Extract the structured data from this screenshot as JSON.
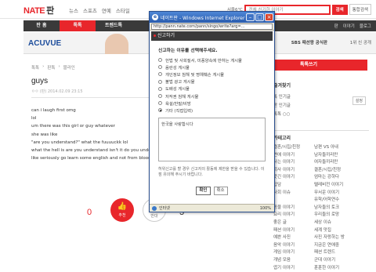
{
  "header": {
    "logo_brand": "NATE",
    "logo_sub": "판",
    "nav": [
      "뉴스",
      "스포츠",
      "연예",
      "스타일"
    ],
    "weather": "서울6℃",
    "search_scope": "전체",
    "search_value": "신기한 이야기",
    "search_button": "검색",
    "detail_search": "통합검색"
  },
  "categories": {
    "items": [
      "판 홈",
      "톡톡",
      "트렌드톡"
    ],
    "active_index": 1,
    "right": [
      "판",
      "이야기",
      "블로그"
    ]
  },
  "ad": {
    "brand": "ACUVUE",
    "sbs": "SBS 패션왕 공식판",
    "right": "1위 신 공개"
  },
  "post": {
    "breadcrumb": [
      "톡톡",
      "판톡",
      "블라인"
    ],
    "title": "guys",
    "meta": "ㅇㅇ (판) 2014.02.09 23:15",
    "lines": [
      "can i laugh first omg",
      "lol",
      "um there was this girl or guy whatever",
      "she was like",
      "\"are you understand?\" what the fuuuuckk lol",
      "what the hell is are you understand isn't it do you understand?",
      "like seriously go learn some english and not from bloody google"
    ],
    "vote_up_count": "0",
    "vote_up_label": "추천",
    "vote_down_label": "반대",
    "vote_down_count": "3"
  },
  "sidebar": {
    "write_button": "톡톡쓰기",
    "fav_title": "즐겨찾기",
    "edit_label": "설정",
    "fav_items": [
      "톡 인기글",
      "판 인기글",
      "톡톡 ○○"
    ],
    "category_title": "카테고리",
    "categories": [
      [
        "결혼/시집/친정",
        "남편 VS 아내"
      ],
      [
        "연애 이야기",
        "남자들끼리만"
      ],
      [
        "사는 이야기",
        "여자들끼리만"
      ],
      [
        "회사 이야기",
        "결혼/시집/친정"
      ],
      [
        "웃긴 이야기",
        "엄마는 강하다"
      ],
      [
        "잡담",
        "텔레비전 이야기"
      ],
      [
        "사회 이슈",
        "무서운 이야기"
      ],
      [
        "",
        "유학/어학연수"
      ],
      [
        "동물 이야기",
        "남자들의 토크"
      ],
      [
        "요리 이야기",
        "우리들의 로망"
      ],
      [
        "좋은 글",
        "세상 이슈"
      ],
      [
        "패션 이야기",
        "세계 맛집"
      ],
      [
        "예쁜 사진",
        "사진 자랑하는 방"
      ],
      [
        "음악 이야기",
        "지금은 연애중"
      ],
      [
        "게임 이야기",
        "패션 트렌드"
      ],
      [
        "개념 모음",
        "군대 이야기"
      ],
      [
        "엽기 이야기",
        "훈훈한 이야기"
      ]
    ],
    "bottom": [
      "TV톡",
      "판사로운"
    ]
  },
  "popup": {
    "window_title": "네이트판 - Windows Internet Explorer",
    "url": "http://pann.nate.com/pann/singo/write?arg=...",
    "dialog_title": "신고하기",
    "question": "신고하는 이유를 선택해주세요.",
    "reasons": [
      "헌법 및 사회질서, 미풍양속에 반하는 게시물",
      "음란성 게시물",
      "개인정보 침해 및 명예훼손 게시물",
      "불법 광고 게시물",
      "도배성 게시물",
      "저작권 침해 게시물",
      "욕설/반말/비방",
      "기타 (직접입력)"
    ],
    "selected_reason_index": 7,
    "textarea_value": "한국을 사랑합시다",
    "warning": "허위신고를 할 경우 신고자의 활동에 제한을 받을 수 있습니다. 이 점 유의해 주시기 바랍니다.",
    "confirm_button": "확인",
    "cancel_button": "취소",
    "status_zone": "인터넷",
    "zoom": "100%"
  }
}
